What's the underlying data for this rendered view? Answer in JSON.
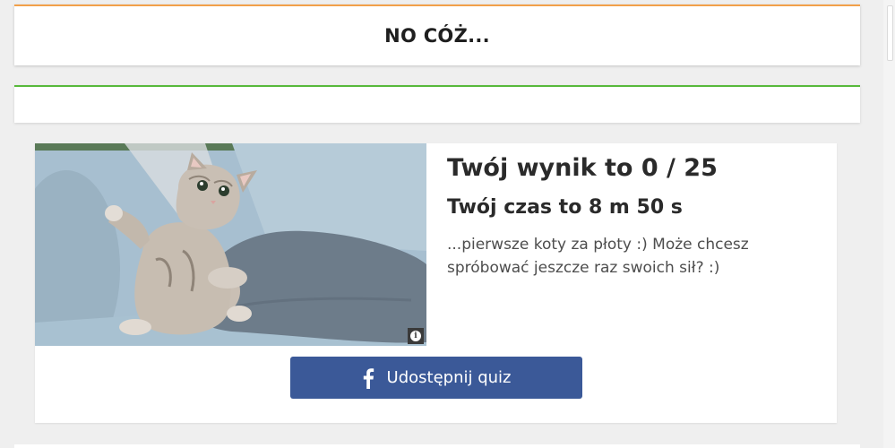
{
  "header": {
    "title": "NO CÓŻ..."
  },
  "result": {
    "score": "Twój wynik to 0 / 25",
    "time": "Twój czas to 8 m 50 s",
    "message": "...pierwsze koty za płoty :) Może chcesz spróbować jeszcze raz swoich sił? :)"
  },
  "image": {
    "info_icon": "info-icon"
  },
  "share": {
    "label": "Udostępnij quiz",
    "icon": "facebook-icon",
    "color": "#3b5998"
  },
  "colors": {
    "accent_orange": "#f2a04a",
    "accent_green": "#57b93b",
    "facebook_blue": "#3b5998"
  }
}
